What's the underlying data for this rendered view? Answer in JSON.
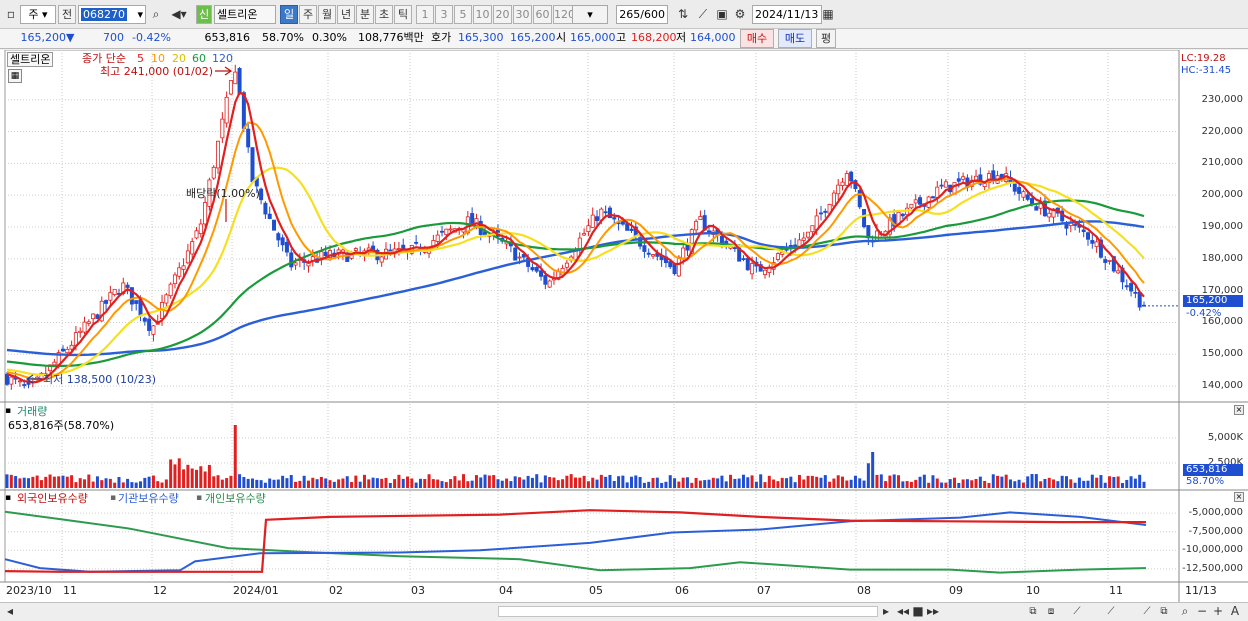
{
  "toolbar": {
    "market_select": "주",
    "prev_label": "전",
    "code_value": "068270",
    "name_badge": "신",
    "stock_name": "셀트리온",
    "periods": [
      "일",
      "주",
      "월",
      "년",
      "분",
      "초",
      "틱"
    ],
    "active_period": "일",
    "intervals": [
      "1",
      "3",
      "5",
      "10",
      "20",
      "30",
      "60",
      "120"
    ],
    "count_value": "265",
    "count_total": "/600",
    "date_value": "2024/11/13"
  },
  "quote": {
    "price": "165,200",
    "change": "700",
    "change_pct": "-0.42%",
    "volume": "653,816",
    "volume_pct": "58.70%",
    "turnover": "0.30%",
    "amount": "108,776백만",
    "bid_label": "호가",
    "bid": "165,300",
    "ask": "165,200",
    "open_label": "시",
    "open": "165,000",
    "high_label": "고",
    "high": "168,200",
    "low_label": "저",
    "low": "164,000",
    "buy_label": "매수",
    "sell_label": "매도",
    "eval_label": "평"
  },
  "price_panel": {
    "stock_tag": "셀트리온",
    "ma_label": "종가 단순",
    "ma_periods": [
      "5",
      "10",
      "20",
      "60",
      "120"
    ],
    "high_note": "최고 241,000 (01/02)",
    "low_note": "최저 138,500 (10/23)",
    "event_note": "배당락(1.00%)",
    "lc": "LC:19.28",
    "hc": "HC:-31.45",
    "last_price": "165,200",
    "last_pct": "-0.42%",
    "y_ticks": [
      "230,000",
      "220,000",
      "210,000",
      "200,000",
      "190,000",
      "180,000",
      "170,000",
      "160,000",
      "150,000",
      "140,000"
    ]
  },
  "volume_panel": {
    "title": "거래량",
    "value": "653,816주(58.70%)",
    "y_ticks": [
      "5,000K",
      "2,500K"
    ],
    "last": "653,816",
    "last_pct": "58.70%"
  },
  "holding_panel": {
    "legend": [
      "외국인보유수량",
      "기관보유수량",
      "개인보유수량"
    ],
    "y_ticks": [
      "-5,000,000",
      "-7,500,000",
      "-10,000,000",
      "-12,500,000"
    ]
  },
  "x_axis": [
    "2023/10",
    "11",
    "12",
    "2024/01",
    "02",
    "03",
    "04",
    "05",
    "06",
    "07",
    "08",
    "09",
    "10",
    "11",
    "11/13"
  ],
  "colors": {
    "up": "#e02020",
    "down": "#1f4fd0",
    "ma5": "#e02020",
    "ma10": "#ff9900",
    "ma20": "#f5e020",
    "ma60": "#1a9a3a",
    "ma120": "#2b5fd8",
    "foreign": "#e02020",
    "institution": "#2b5fd8",
    "individual": "#2e9a4e"
  },
  "chart_data": {
    "type": "candlestick",
    "title": "셀트리온",
    "x_range": [
      "2023/10",
      "2024/11/13"
    ],
    "price_ylim": [
      135000,
      245000
    ],
    "price_anchors": [
      {
        "x": "2023/10",
        "y": 143000
      },
      {
        "x": "2023/10/23",
        "y": 138500
      },
      {
        "x": "2023/11",
        "y": 150000
      },
      {
        "x": "2023/11/mid",
        "y": 172000
      },
      {
        "x": "2023/12",
        "y": 158000
      },
      {
        "x": "2023/12/late",
        "y": 190000
      },
      {
        "x": "2024/01/02",
        "y": 241000
      },
      {
        "x": "2024/01/mid",
        "y": 205000
      },
      {
        "x": "2024/01/late",
        "y": 178000
      },
      {
        "x": "2024/02",
        "y": 181000
      },
      {
        "x": "2024/03",
        "y": 182000
      },
      {
        "x": "2024/03/late",
        "y": 192000
      },
      {
        "x": "2024/04",
        "y": 183000
      },
      {
        "x": "2024/04/late",
        "y": 172000
      },
      {
        "x": "2024/05",
        "y": 195000
      },
      {
        "x": "2024/06",
        "y": 177000
      },
      {
        "x": "2024/06/late",
        "y": 192000
      },
      {
        "x": "2024/07",
        "y": 176000
      },
      {
        "x": "2024/07/late",
        "y": 188000
      },
      {
        "x": "2024/08",
        "y": 209000
      },
      {
        "x": "2024/08/mid",
        "y": 186000
      },
      {
        "x": "2024/09",
        "y": 202000
      },
      {
        "x": "2024/09/late",
        "y": 207000
      },
      {
        "x": "2024/10",
        "y": 199000
      },
      {
        "x": "2024/10/late",
        "y": 187000
      },
      {
        "x": "2024/11/13",
        "y": 165200
      }
    ],
    "series": [
      {
        "name": "5",
        "type": "sma"
      },
      {
        "name": "10",
        "type": "sma"
      },
      {
        "name": "20",
        "type": "sma"
      },
      {
        "name": "60",
        "type": "sma"
      },
      {
        "name": "120",
        "type": "sma"
      }
    ],
    "volume_ylim": [
      0,
      7000000
    ],
    "volume_max_label": "5,000K",
    "holding_ylim": [
      -14000000,
      -3500000
    ]
  }
}
